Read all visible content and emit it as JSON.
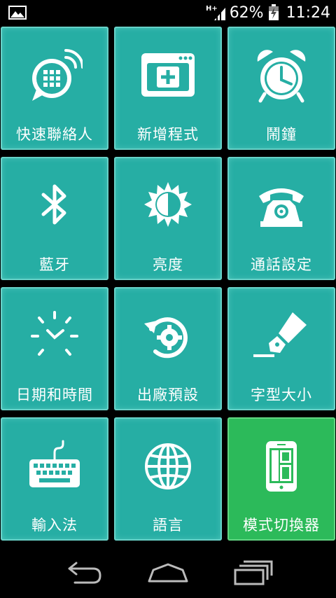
{
  "status_bar": {
    "left_icon": "image-notification-icon",
    "network_label": "H+",
    "battery": "62%",
    "time": "11:24"
  },
  "tiles": [
    {
      "label": "快速聯絡人",
      "icon": "speed-dial-chat-icon"
    },
    {
      "label": "新增程式",
      "icon": "add-app-icon"
    },
    {
      "label": "鬧鐘",
      "icon": "alarm-clock-icon"
    },
    {
      "label": "藍牙",
      "icon": "bluetooth-icon"
    },
    {
      "label": "亮度",
      "icon": "brightness-icon"
    },
    {
      "label": "通話設定",
      "icon": "phone-gear-icon"
    },
    {
      "label": "日期和時間",
      "icon": "clock-icon"
    },
    {
      "label": "出廠預設",
      "icon": "factory-reset-icon"
    },
    {
      "label": "字型大小",
      "icon": "pen-icon"
    },
    {
      "label": "輸入法",
      "icon": "keyboard-icon"
    },
    {
      "label": "語言",
      "icon": "globe-icon"
    },
    {
      "label": "模式切換器",
      "icon": "phone-mode-icon"
    }
  ],
  "colors": {
    "tile": "#26aea4",
    "tile_active": "#2cba5a",
    "background": "#000000"
  },
  "nav": {
    "back": "back-icon",
    "home": "home-icon",
    "recents": "recents-icon"
  }
}
